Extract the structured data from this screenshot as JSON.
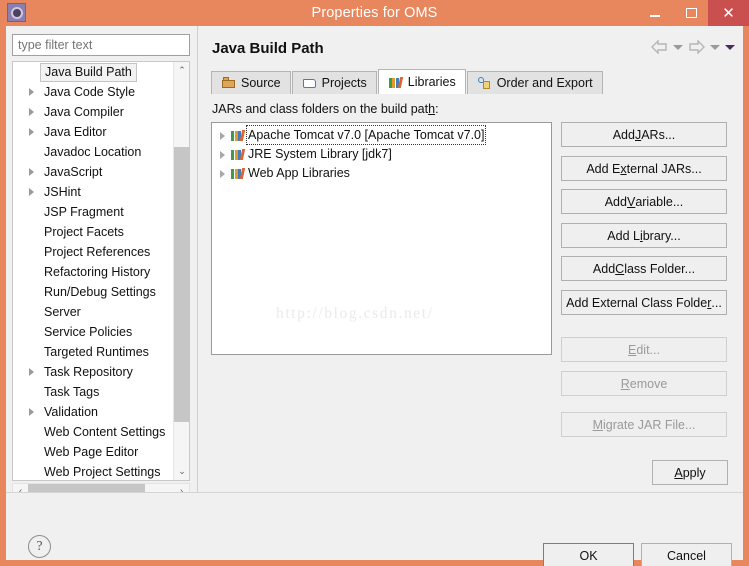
{
  "window": {
    "title": "Properties for OMS",
    "icon": "eclipse-gear-icon",
    "minimize_label": "–",
    "maximize_label": "□",
    "close_label": "✕",
    "accent_color": "#e8875e",
    "close_color": "#ca4f4f"
  },
  "sidebar": {
    "filter": {
      "value": "",
      "placeholder": "type filter text"
    },
    "items": [
      {
        "label": "Java Build Path",
        "expandable": false,
        "selected": true
      },
      {
        "label": "Java Code Style",
        "expandable": true,
        "selected": false
      },
      {
        "label": "Java Compiler",
        "expandable": true,
        "selected": false
      },
      {
        "label": "Java Editor",
        "expandable": true,
        "selected": false
      },
      {
        "label": "Javadoc Location",
        "expandable": false,
        "selected": false
      },
      {
        "label": "JavaScript",
        "expandable": true,
        "selected": false
      },
      {
        "label": "JSHint",
        "expandable": true,
        "selected": false
      },
      {
        "label": "JSP Fragment",
        "expandable": false,
        "selected": false
      },
      {
        "label": "Project Facets",
        "expandable": false,
        "selected": false
      },
      {
        "label": "Project References",
        "expandable": false,
        "selected": false
      },
      {
        "label": "Refactoring History",
        "expandable": false,
        "selected": false
      },
      {
        "label": "Run/Debug Settings",
        "expandable": false,
        "selected": false
      },
      {
        "label": "Server",
        "expandable": false,
        "selected": false
      },
      {
        "label": "Service Policies",
        "expandable": false,
        "selected": false
      },
      {
        "label": "Targeted Runtimes",
        "expandable": false,
        "selected": false
      },
      {
        "label": "Task Repository",
        "expandable": true,
        "selected": false
      },
      {
        "label": "Task Tags",
        "expandable": false,
        "selected": false
      },
      {
        "label": "Validation",
        "expandable": true,
        "selected": false
      },
      {
        "label": "Web Content Settings",
        "expandable": false,
        "selected": false
      },
      {
        "label": "Web Page Editor",
        "expandable": false,
        "selected": false
      },
      {
        "label": "Web Project Settings",
        "expandable": false,
        "selected": false
      }
    ],
    "scroll_up": "⌃",
    "scroll_down": "⌄",
    "scroll_left": "‹",
    "scroll_right": "›"
  },
  "page": {
    "title": "Java Build Path",
    "nav": {
      "back": "back-arrow",
      "back_menu": "chevron-down-icon",
      "forward": "forward-arrow",
      "forward_menu": "chevron-down-icon",
      "view_menu": "view-menu-icon"
    },
    "tabs": [
      {
        "label": "Source",
        "icon": "source-folder-icon",
        "active": false
      },
      {
        "label": "Projects",
        "icon": "projects-folder-icon",
        "active": false
      },
      {
        "label": "Libraries",
        "icon": "libraries-books-icon",
        "active": true
      },
      {
        "label": "Order and Export",
        "icon": "order-export-icon",
        "active": false
      }
    ],
    "list_label_pre": "JARs and class folders on the build pat",
    "list_label_mnemonic": "h",
    "list_label_post": ":",
    "libraries": [
      {
        "label": "Apache Tomcat v7.0 [Apache Tomcat v7.0]",
        "icon": "library-icon",
        "expandable": true,
        "focused": true
      },
      {
        "label": "JRE System Library [jdk7]",
        "icon": "library-icon",
        "expandable": true,
        "focused": false
      },
      {
        "label": "Web App Libraries",
        "icon": "library-icon",
        "expandable": true,
        "focused": false
      }
    ],
    "watermark": "http://blog.csdn.net/",
    "side_buttons": [
      {
        "pre": "Add ",
        "mn": "J",
        "post": "ARs...",
        "enabled": true
      },
      {
        "pre": "Add E",
        "mn": "x",
        "post": "ternal JARs...",
        "enabled": true
      },
      {
        "pre": "Add ",
        "mn": "V",
        "post": "ariable...",
        "enabled": true
      },
      {
        "pre": "Add L",
        "mn": "i",
        "post": "brary...",
        "enabled": true
      },
      {
        "pre": "Add ",
        "mn": "C",
        "post": "lass Folder...",
        "enabled": true
      },
      {
        "pre": "Add External Class Folde",
        "mn": "r",
        "post": "...",
        "enabled": true
      },
      {
        "pre": "",
        "mn": "E",
        "post": "dit...",
        "enabled": false
      },
      {
        "pre": "",
        "mn": "R",
        "post": "emove",
        "enabled": false
      },
      {
        "pre": "",
        "mn": "M",
        "post": "igrate JAR File...",
        "enabled": false
      }
    ],
    "apply": {
      "pre": "",
      "mn": "A",
      "post": "pply"
    }
  },
  "footer": {
    "help_label": "?",
    "ok_label": "OK",
    "cancel_label": "Cancel"
  }
}
